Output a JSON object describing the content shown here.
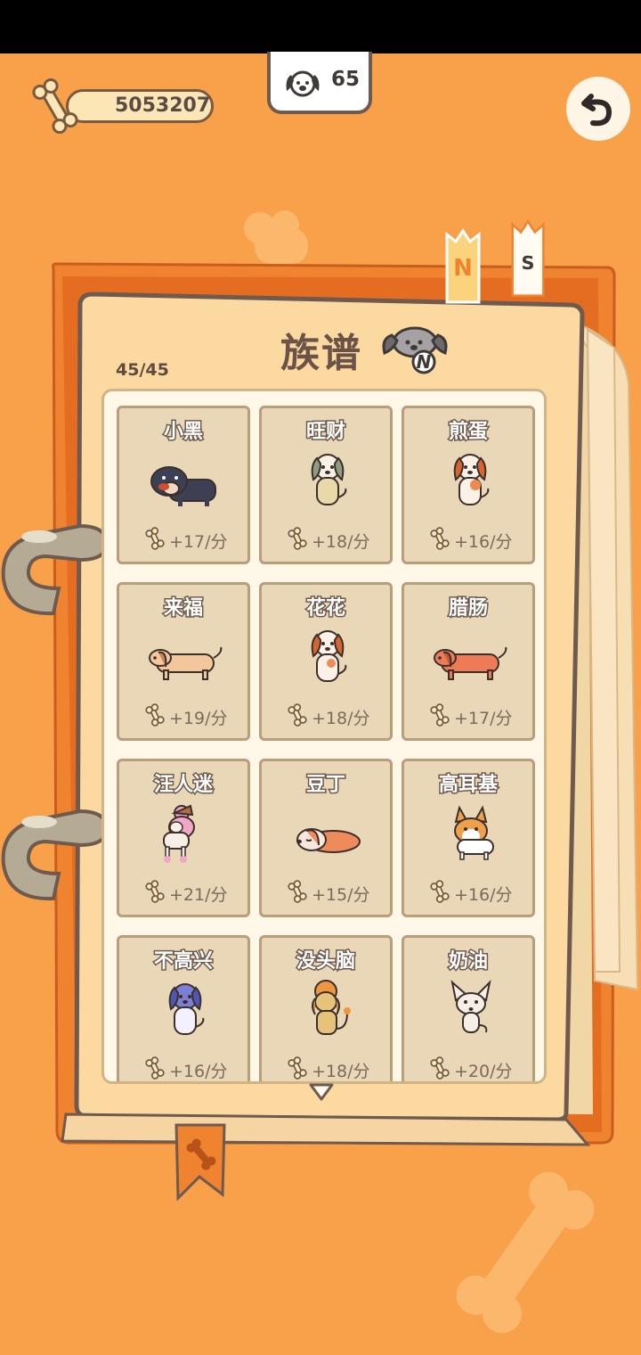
{
  "header": {
    "bones": "5053207",
    "dog_count": "65"
  },
  "book": {
    "title": "族谱",
    "progress": "45/45",
    "tabs": [
      "N",
      "S"
    ],
    "active_tab_icon_letter": "N"
  },
  "dogs": [
    {
      "name": "小黑",
      "rate": "+17/分",
      "color": "#3d3f55",
      "style": "black-lab"
    },
    {
      "name": "旺财",
      "rate": "+18/分",
      "color": "#e9d9a8",
      "style": "beige-hound"
    },
    {
      "name": "煎蛋",
      "rate": "+16/分",
      "color": "#ef8a4e",
      "style": "spaniel"
    },
    {
      "name": "来福",
      "rate": "+19/分",
      "color": "#f3c79b",
      "style": "lying"
    },
    {
      "name": "花花",
      "rate": "+18/分",
      "color": "#f08a59",
      "style": "sitting-spotted"
    },
    {
      "name": "腊肠",
      "rate": "+17/分",
      "color": "#ee7b56",
      "style": "dachshund"
    },
    {
      "name": "汪人迷",
      "rate": "+21/分",
      "color": "#f1a8c8",
      "style": "poodle"
    },
    {
      "name": "豆丁",
      "rate": "+15/分",
      "color": "#ef8a5a",
      "style": "sleeping"
    },
    {
      "name": "高耳基",
      "rate": "+16/分",
      "color": "#f0a04a",
      "style": "corgi"
    },
    {
      "name": "不高兴",
      "rate": "+16/分",
      "color": "#7b80d6",
      "style": "blue-sitting"
    },
    {
      "name": "没头脑",
      "rate": "+18/分",
      "color": "#e7c27a",
      "style": "lion"
    },
    {
      "name": "奶油",
      "rate": "+20/分",
      "color": "#f7efe6",
      "style": "chihuahua"
    }
  ]
}
